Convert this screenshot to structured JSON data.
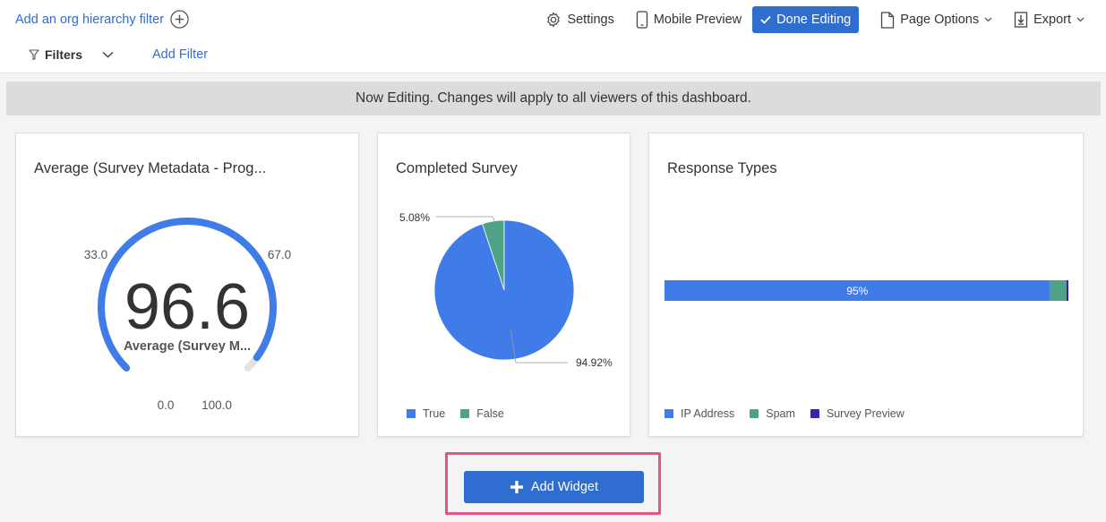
{
  "toolbar": {
    "org_filter_label": "Add an org hierarchy filter",
    "settings_label": "Settings",
    "mobile_preview_label": "Mobile Preview",
    "done_editing_label": "Done Editing",
    "page_options_label": "Page Options",
    "export_label": "Export",
    "filters_label": "Filters",
    "add_filter_label": "Add Filter"
  },
  "banner": {
    "text": "Now Editing. Changes will apply to all viewers of this dashboard."
  },
  "gauge_widget": {
    "title": "Average (Survey Metadata - Prog...",
    "value": "96.6",
    "value_num": 96.6,
    "caption": "Average (Survey M...",
    "min": 0,
    "max": 100,
    "tick_labels": {
      "t0": "0.0",
      "t33": "33.0",
      "t67": "67.0",
      "t100": "100.0"
    },
    "colors": {
      "fill": "#3f7ce8",
      "track": "#e2e2e2"
    }
  },
  "pie_widget": {
    "title": "Completed Survey",
    "chart_data": {
      "type": "pie",
      "slices": [
        {
          "name": "True",
          "value": 94.92,
          "label": "94.92%",
          "color": "#3f7ce8"
        },
        {
          "name": "False",
          "value": 5.08,
          "label": "5.08%",
          "color": "#4ea386"
        }
      ]
    },
    "legend": [
      {
        "label": "True",
        "color": "#3f7ce8"
      },
      {
        "label": "False",
        "color": "#4ea386"
      }
    ]
  },
  "bar_widget": {
    "title": "Response Types",
    "chart_data": {
      "type": "bar",
      "orientation": "horizontal-stacked",
      "series": [
        {
          "name": "IP Address",
          "value": 95.5,
          "label": "95%",
          "color": "#3f7ce8"
        },
        {
          "name": "Spam",
          "value": 4.0,
          "color": "#4ea386"
        },
        {
          "name": "Survey Preview",
          "value": 0.5,
          "color": "#3d1fb8"
        }
      ]
    },
    "legend": [
      {
        "label": "IP Address",
        "color": "#3f7ce8"
      },
      {
        "label": "Spam",
        "color": "#4ea386"
      },
      {
        "label": "Survey Preview",
        "color": "#3d1fb8"
      }
    ]
  },
  "add_widget": {
    "label": "Add Widget"
  }
}
